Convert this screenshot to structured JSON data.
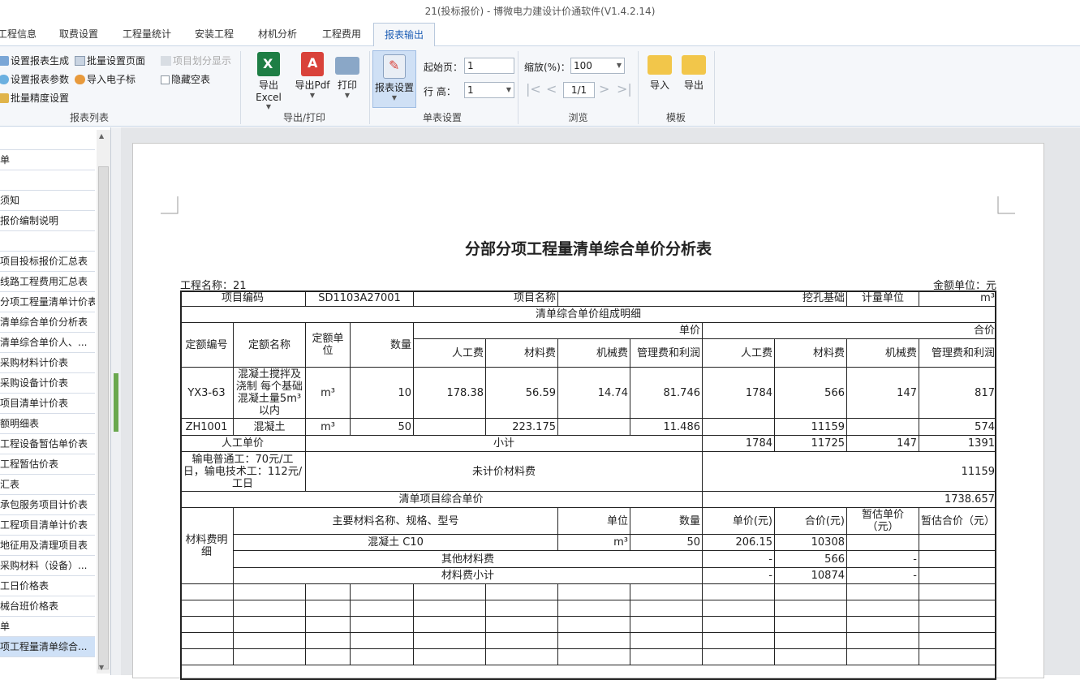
{
  "app": {
    "title": "21(投标报价) - 博微电力建设计价通软件(V1.4.2.14)"
  },
  "tabs": [
    "工程信息",
    "取费设置",
    "工程量统计",
    "安装工程",
    "材机分析",
    "工程费用",
    "报表输出"
  ],
  "ribbon": {
    "report_list": {
      "set_generate": "设置报表生成",
      "set_params": "设置报表参数",
      "batch_precision": "批量精度设置",
      "batch_page": "批量设置页面",
      "import_eindex": "导入电子标",
      "item_split_show": "项目划分显示",
      "hide_empty": "隐藏空表",
      "group_label": "报表列表"
    },
    "export": {
      "excel": "导出Excel",
      "pdf": "导出Pdf",
      "print": "打印",
      "group_label": "导出/打印"
    },
    "sheet": {
      "report_settings": "报表设置",
      "start_page_label": "起始页：",
      "start_page_value": "1",
      "row_height_label": "行  高：",
      "row_height_value": "1",
      "group_label": "单表设置"
    },
    "browse": {
      "zoom_label": "缩放(%)：",
      "zoom_value": "100",
      "page_value": "1/1",
      "group_label": "浏览"
    },
    "template": {
      "import": "导入",
      "export": "导出",
      "group_label": "模板"
    }
  },
  "sidebar": {
    "items": [
      "",
      "单",
      "",
      "须知",
      "报价编制说明",
      "",
      "项目投标报价汇总表",
      "线路工程费用汇总表",
      "分项工程量清单计价表",
      "清单综合单价分析表",
      "清单综合单价人、...",
      "采购材料计价表",
      "采购设备计价表",
      "项目清单计价表",
      "额明细表",
      "工程设备暂估单价表",
      "工程暂估价表",
      "汇表",
      "承包服务项目计价表",
      "工程项目清单计价表",
      "地征用及清理项目表",
      "采购材料（设备）...",
      "工日价格表",
      "械台班价格表",
      "单",
      "项工程量清单综合..."
    ]
  },
  "report": {
    "title": "分部分项工程量清单综合单价分析表",
    "project_name": "工程名称：21",
    "amount_unit": "金额单位：元",
    "hdr": {
      "item_code_label": "项目编码",
      "item_code": "SD1103A27001",
      "item_name_label": "项目名称",
      "item_name": "挖孔基础",
      "unit_label": "计量单位",
      "unit": "m³",
      "detail_title": "清单综合单价组成明细",
      "quota_no": "定额编号",
      "quota_name": "定额名称",
      "quota_unit": "定额单位",
      "quantity": "数量",
      "unit_price": "单价",
      "total_price": "合价",
      "labor": "人工费",
      "material": "材料费",
      "machine": "机械费",
      "mgmt": "管理费和利润"
    },
    "rows": [
      {
        "code": "YX3-63",
        "name": "混凝土搅拌及浇制 每个基础混凝土量5m³以内",
        "unit": "m³",
        "qty": "10",
        "u_labor": "178.38",
        "u_mat": "56.59",
        "u_mach": "14.74",
        "u_mgmt": "81.746",
        "t_labor": "1784",
        "t_mat": "566",
        "t_mach": "147",
        "t_mgmt": "817"
      },
      {
        "code": "ZH1001",
        "name": "混凝土",
        "unit": "m³",
        "qty": "50",
        "u_labor": "",
        "u_mat": "223.175",
        "u_mach": "",
        "u_mgmt": "11.486",
        "t_labor": "",
        "t_mat": "11159",
        "t_mach": "",
        "t_mgmt": "574"
      }
    ],
    "labor_price_label": "人工单价",
    "subtotal_label": "小计",
    "subtotal": {
      "labor": "1784",
      "mat": "11725",
      "mach": "147",
      "mgmt": "1391"
    },
    "labor_note": "输电普通工：70元/工日，输电技术工：112元/工日",
    "unpriced_label": "未计价材料费",
    "unpriced_value": "11159",
    "composite_label": "清单项目综合单价",
    "composite_value": "1738.657",
    "mat": {
      "section_label": "材料费明细",
      "name_spec": "主要材料名称、规格、型号",
      "unit": "单位",
      "qty": "数量",
      "price": "单价(元)",
      "total": "合价(元)",
      "est_price": "暂估单价（元）",
      "est_total": "暂估合价（元）",
      "row1": {
        "name": "混凝土 C10",
        "unit": "m³",
        "qty": "50",
        "price": "206.15",
        "total": "10308"
      },
      "other_label": "其他材料费",
      "other": {
        "price": "-",
        "total": "566",
        "est": "-"
      },
      "sub_label": "材料费小计",
      "sub": {
        "price": "-",
        "total": "10874",
        "est": "-"
      }
    }
  }
}
